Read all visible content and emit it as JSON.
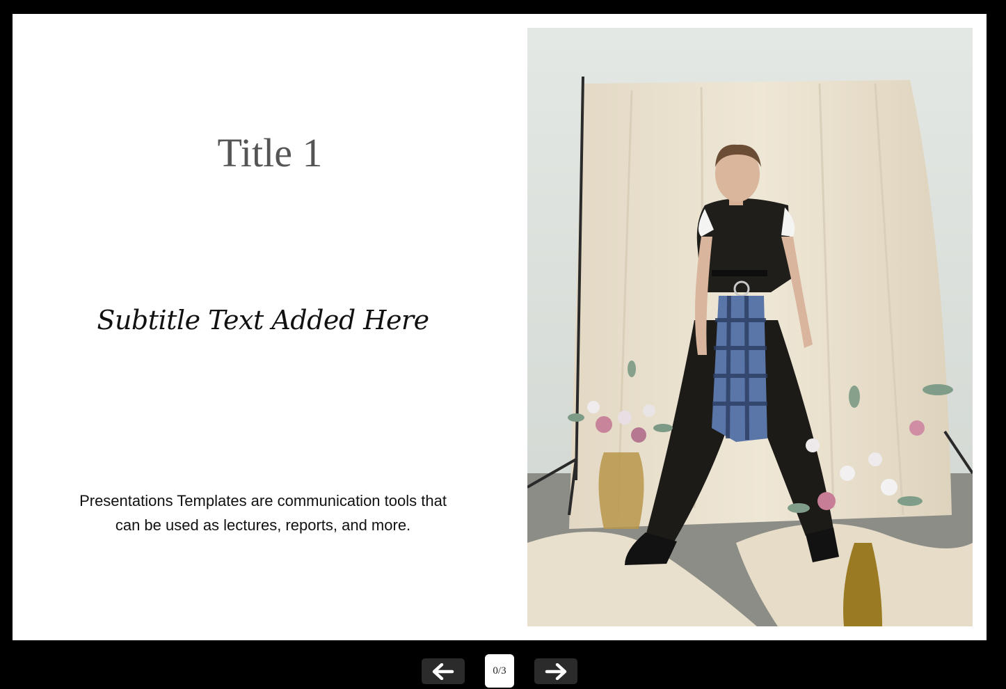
{
  "slide": {
    "title": "Title 1",
    "subtitle": "Subtitle Text Added Here",
    "body_line1": "Presentations Templates are communication tools that",
    "body_line2": "can be used as lectures, reports, and more.",
    "photo_icon": "fashion-photo"
  },
  "navigation": {
    "prev_icon": "arrow-left-icon",
    "next_icon": "arrow-right-icon",
    "counter": "0/3"
  },
  "colors": {
    "background": "#000000",
    "slide": "#ffffff",
    "title": "#555555",
    "nav_button": "#2b2b2b"
  }
}
